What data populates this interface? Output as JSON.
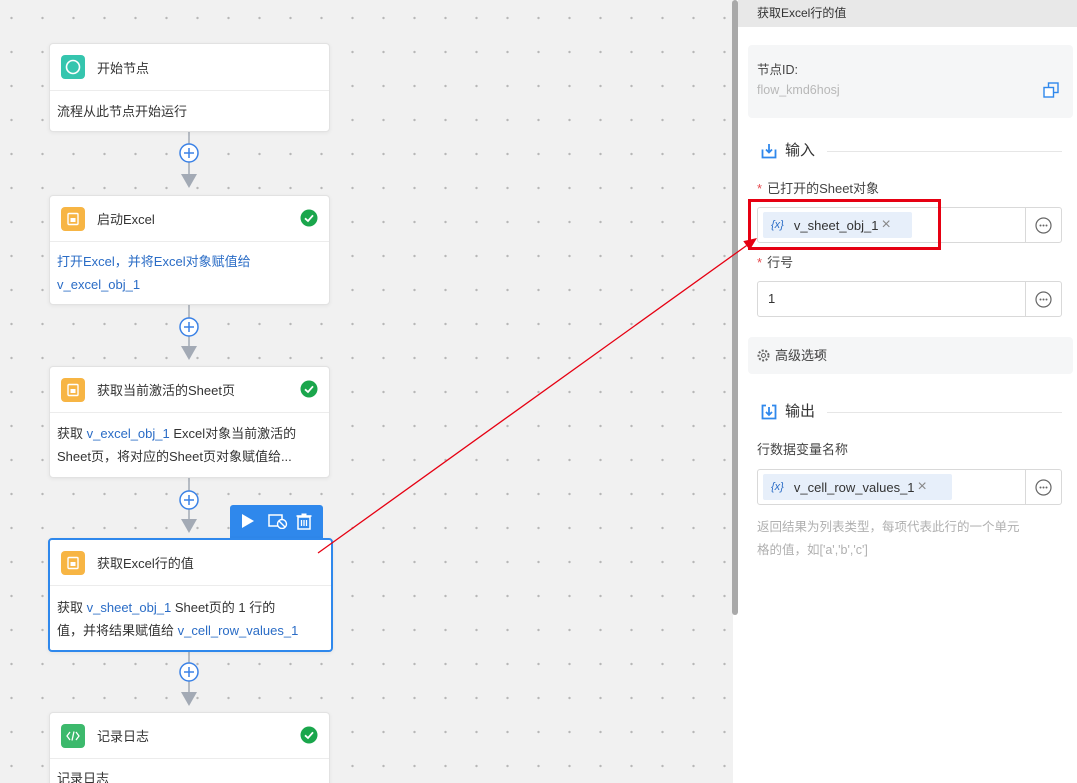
{
  "canvas": {
    "nodes": [
      {
        "title": "开始节点",
        "icon": "start-circle-icon",
        "status_icon": null,
        "body": [
          [
            "流程从此节点开始运行"
          ]
        ]
      },
      {
        "title": "启动Excel",
        "icon": "excel-file-icon",
        "status_icon": "success-check-icon",
        "body": [
          [
            "打开Excel，并将Excel对象赋值给"
          ],
          [
            "v_excel_obj_1"
          ]
        ]
      },
      {
        "title": "获取当前激活的Sheet页",
        "icon": "excel-file-icon",
        "status_icon": "success-check-icon",
        "body": [
          [
            "获取 ",
            "v_excel_obj_1",
            " Excel对象当前激活的"
          ],
          [
            "Sheet页，将对应的Sheet页对象赋值给..."
          ]
        ]
      },
      {
        "title": "获取Excel行的值",
        "icon": "excel-file-icon",
        "status_icon": null,
        "selected": true,
        "body": [
          [
            "获取 ",
            "v_sheet_obj_1",
            " Sheet页的 1 行的"
          ],
          [
            "值，并将结果赋值给 ",
            "v_cell_row_values_1"
          ]
        ]
      },
      {
        "title": "记录日志",
        "icon": "code-icon",
        "status_icon": "success-check-icon",
        "body": [
          [
            "记录日志"
          ]
        ]
      }
    ],
    "node_toolbar": {
      "icons": [
        "play-icon",
        "disable-icon",
        "delete-icon"
      ]
    },
    "connector_icon": "plus-circle-icon"
  },
  "panel": {
    "title": "获取Excel行的值",
    "node_id": {
      "label": "节点ID:",
      "value": "flow_kmd6hosj",
      "icon": "copy-icon"
    },
    "input_section": {
      "title": "输入",
      "icon": "input-tray-icon"
    },
    "fields": [
      {
        "required": "*",
        "label": "已打开的Sheet对象",
        "chip": {
          "icon": "{x}",
          "value": "v_sheet_obj_1"
        },
        "button_icon": "more-circle-icon"
      },
      {
        "required": "*",
        "label": "行号",
        "value": "1",
        "button_icon": "more-circle-icon"
      }
    ],
    "advanced": {
      "label": "高级选项",
      "icon": "gear-icon",
      "expanded": false
    },
    "output_section": {
      "title": "输出",
      "icon": "output-tray-icon"
    },
    "output_field": {
      "label": "行数据变量名称",
      "chip": {
        "icon": "{x}",
        "value": "v_cell_row_values_1"
      },
      "button_icon": "more-circle-icon"
    },
    "help_lines": [
      "返回结果为列表类型，每项代表此行的一个单元",
      "格的值，如['a','b','c']"
    ]
  },
  "colors": {
    "accent": "#2f88ec",
    "success": "#1aa64c",
    "variable": "#2a6cc6",
    "annotation": "#e60012",
    "start_icon": "#35c5ae",
    "excel_icon": "#f7b544",
    "log_icon": "#3cb96c"
  }
}
